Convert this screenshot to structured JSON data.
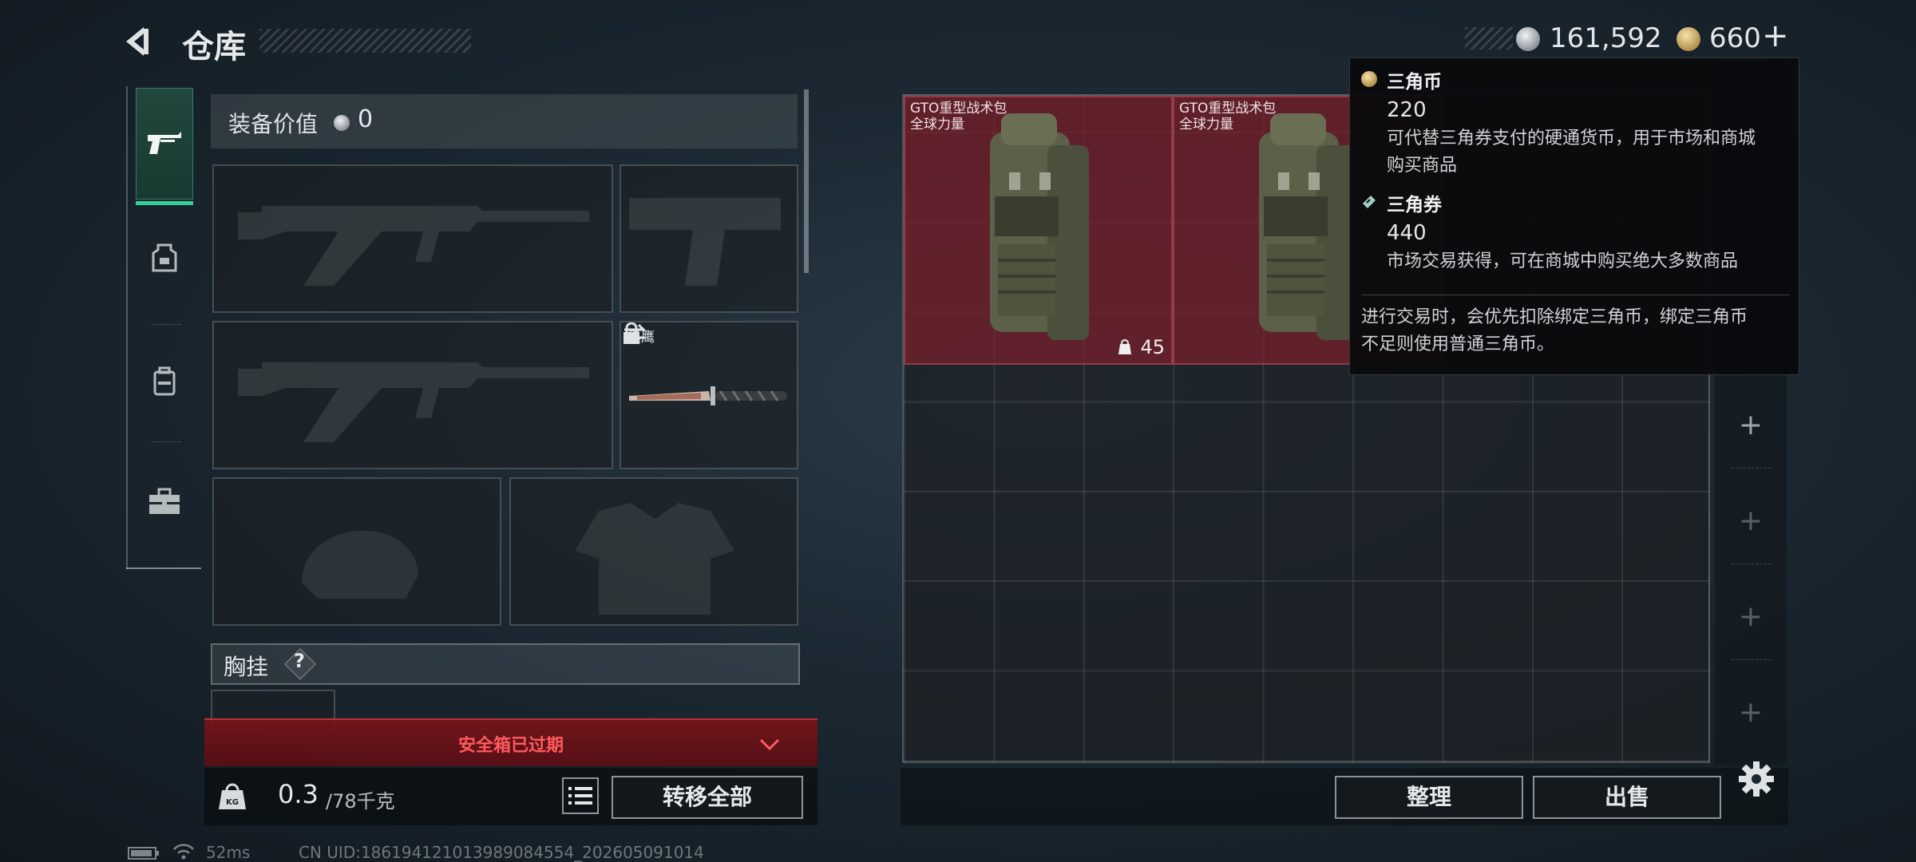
{
  "header": {
    "title": "仓库",
    "back_icon": "back-arrow-icon"
  },
  "currency": {
    "silver_amount": "161,592",
    "gold_amount": "660",
    "gold_plus": "+"
  },
  "left_tabs": [
    {
      "name": "pistol-icon",
      "active": true
    },
    {
      "name": "rig-icon",
      "active": false
    },
    {
      "name": "backpack-icon",
      "active": false
    },
    {
      "name": "toolbox-icon",
      "active": false
    }
  ],
  "loadout": {
    "value_label": "装备价值",
    "value_amount": "0",
    "knife_name": "黑鹰",
    "chest_label": "胸挂",
    "chest_help": "?"
  },
  "alert": {
    "safe_box": "安全箱已过期"
  },
  "footer_left": {
    "weight_current": "0.3",
    "weight_max": "/78千克",
    "transfer_all": "转移全部"
  },
  "stash": {
    "items": [
      {
        "name_line1": "GTO重型战术包",
        "name_line2": "全球力量",
        "count": "45"
      },
      {
        "name_line1": "GTO重型战术包",
        "name_line2": "全球力量",
        "count": ""
      }
    ],
    "sort_label": "整理",
    "sell_label": "出售"
  },
  "tooltip": {
    "coin_name": "三角币",
    "coin_amount": "220",
    "coin_desc_1": "可代替三角券支付的硬通货币，用于市场和商城",
    "coin_desc_2": "购买商品",
    "ticket_name": "三角券",
    "ticket_amount": "440",
    "ticket_desc": "市场交易获得，可在商城中购买绝大多数商品",
    "note_1": "进行交易时，会优先扣除绑定三角币，绑定三角币",
    "note_2": "不足则使用普通三角币。"
  },
  "status_bar": {
    "ping": "52ms",
    "uid": "CN UID:18619412101398908455​4_202605091014"
  },
  "colors": {
    "accent": "#31d198",
    "alert_red": "#ff5a5e",
    "item_bg": "#7b202d"
  }
}
